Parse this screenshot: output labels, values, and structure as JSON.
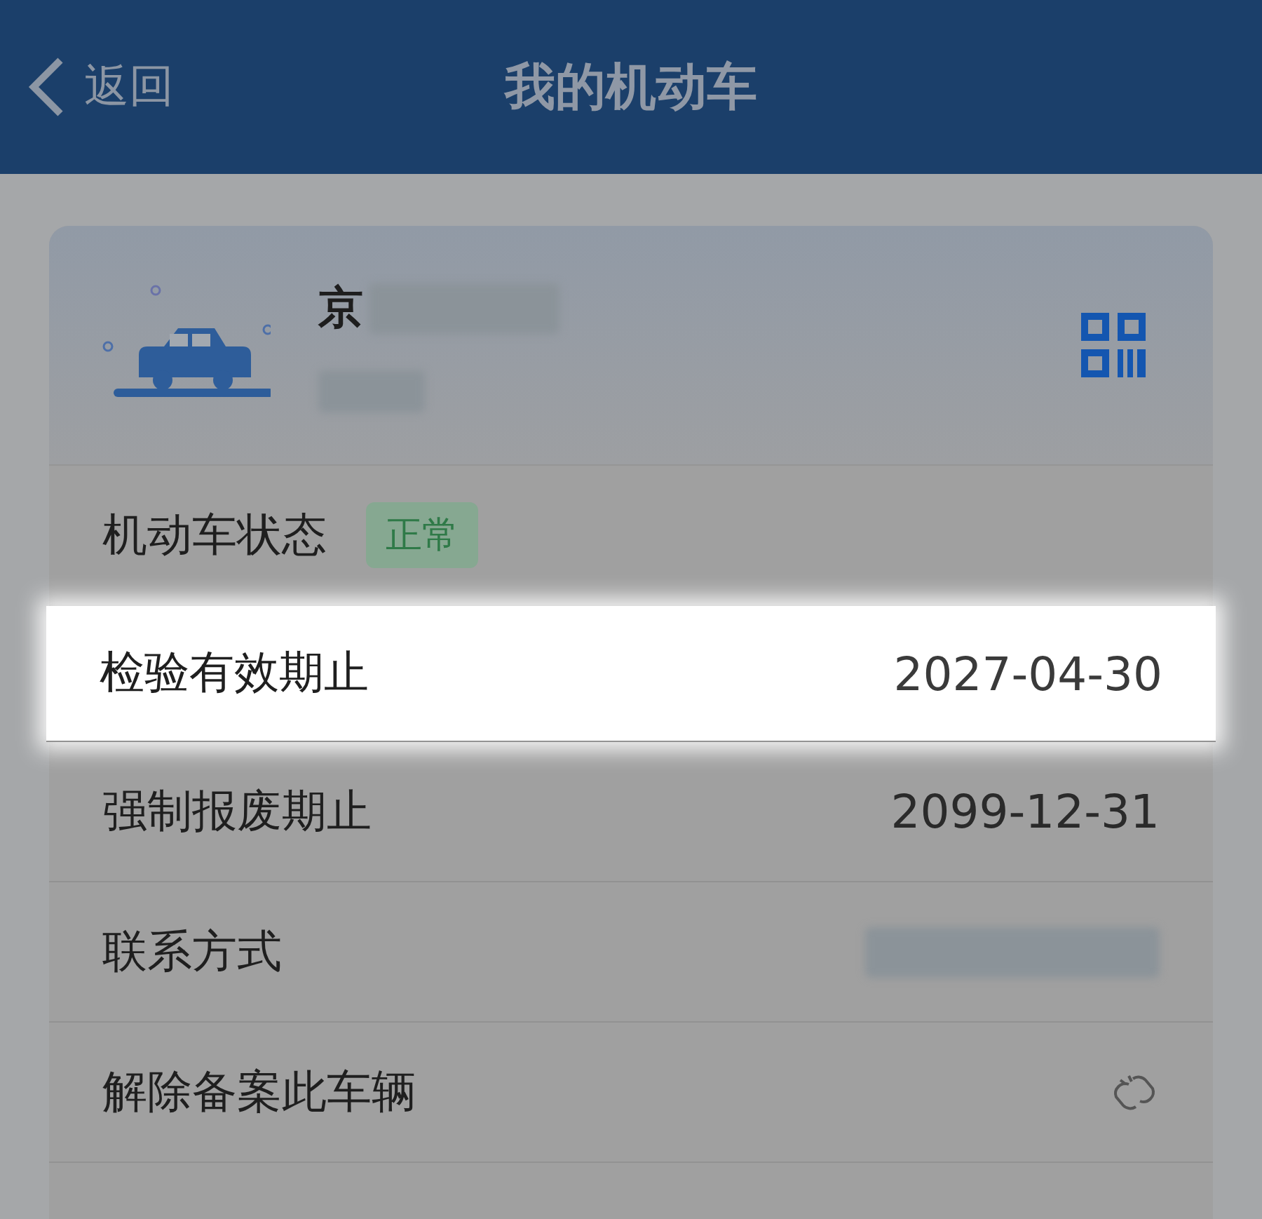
{
  "header": {
    "back_label": "返回",
    "title": "我的机动车"
  },
  "vehicle": {
    "plate_prefix": "京"
  },
  "rows": [
    {
      "kind": "status",
      "label": "机动车状态",
      "badge": "正常",
      "highlighted": false
    },
    {
      "kind": "value",
      "label": "检验有效期止",
      "value": "2027-04-30",
      "highlighted": true
    },
    {
      "kind": "value",
      "label": "强制报废期止",
      "value": "2099-12-31",
      "highlighted": false
    },
    {
      "kind": "blurred",
      "label": "联系方式",
      "highlighted": false
    },
    {
      "kind": "icon",
      "label": "解除备案此车辆",
      "highlighted": false
    }
  ]
}
